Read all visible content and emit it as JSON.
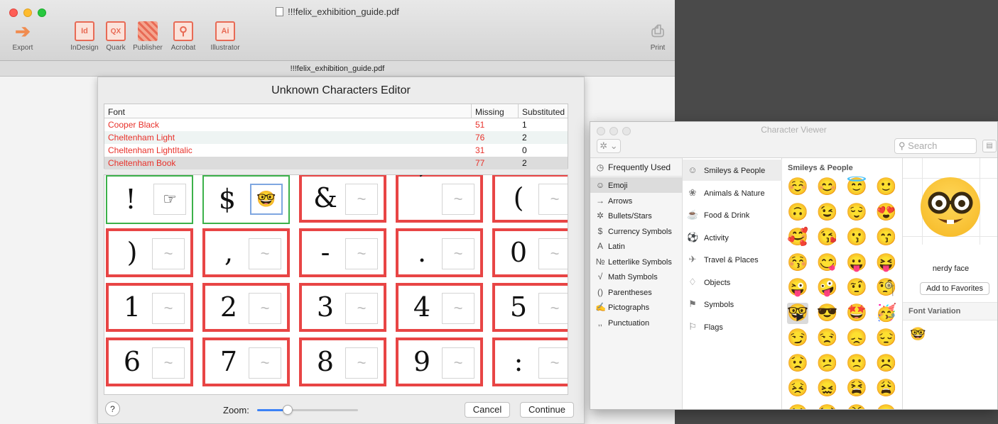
{
  "window": {
    "title": "!!!felix_exhibition_guide.pdf",
    "subtitle": "!!!felix_exhibition_guide.pdf"
  },
  "toolbar": {
    "export_label": "Export",
    "indesign_label": "InDesign",
    "indesign_glyph": "Id",
    "quark_label": "Quark",
    "quark_glyph": "QX",
    "publisher_label": "Publisher",
    "acrobat_label": "Acrobat",
    "illustrator_label": "Illustrator",
    "illustrator_glyph": "Ai",
    "print_label": "Print"
  },
  "editor": {
    "title": "Unknown Characters Editor",
    "columns": {
      "font": "Font",
      "missing": "Missing",
      "substituted": "Substituted"
    },
    "rows": [
      {
        "font": "Cooper Black",
        "missing": "51",
        "substituted": "1"
      },
      {
        "font": "Cheltenham Light",
        "missing": "76",
        "substituted": "2"
      },
      {
        "font": "Cheltenham LightItalic",
        "missing": "31",
        "substituted": "0"
      },
      {
        "font": "Cheltenham Book",
        "missing": "77",
        "substituted": "2"
      }
    ],
    "placeholder_glyph": "~",
    "cells": [
      {
        "char": "!",
        "sub": "☞"
      },
      {
        "char": "$",
        "sub": "🤓"
      },
      {
        "char": "&",
        "sub": ""
      },
      {
        "char": "’",
        "sub": ""
      },
      {
        "char": "(",
        "sub": ""
      },
      {
        "char": ")",
        "sub": ""
      },
      {
        "char": ",",
        "sub": ""
      },
      {
        "char": "-",
        "sub": ""
      },
      {
        "char": ".",
        "sub": ""
      },
      {
        "char": "0",
        "sub": ""
      },
      {
        "char": "1",
        "sub": ""
      },
      {
        "char": "2",
        "sub": ""
      },
      {
        "char": "3",
        "sub": ""
      },
      {
        "char": "4",
        "sub": ""
      },
      {
        "char": "5",
        "sub": ""
      },
      {
        "char": "6",
        "sub": ""
      },
      {
        "char": "7",
        "sub": ""
      },
      {
        "char": "8",
        "sub": ""
      },
      {
        "char": "9",
        "sub": ""
      },
      {
        "char": ":",
        "sub": ""
      }
    ],
    "help_label": "?",
    "zoom_label": "Zoom:",
    "zoom_level": 0.3,
    "cancel_label": "Cancel",
    "continue_label": "Continue"
  },
  "character_viewer": {
    "title": "Character Viewer",
    "gear_label": "✲ ⌄",
    "search_placeholder": "Search",
    "categories": [
      {
        "icon": "◷",
        "label": "Frequently Used"
      },
      {
        "icon": "☺",
        "label": "Emoji"
      },
      {
        "icon": "→",
        "label": "Arrows"
      },
      {
        "icon": "✲",
        "label": "Bullets/Stars"
      },
      {
        "icon": "$",
        "label": "Currency Symbols"
      },
      {
        "icon": "A",
        "label": "Latin"
      },
      {
        "icon": "№",
        "label": "Letterlike Symbols"
      },
      {
        "icon": "√",
        "label": "Math Symbols"
      },
      {
        "icon": "()",
        "label": "Parentheses"
      },
      {
        "icon": "✍",
        "label": "Pictographs"
      },
      {
        "icon": "‚,",
        "label": "Punctuation"
      }
    ],
    "subcategories": [
      {
        "icon": "☺",
        "label": "Smileys & People"
      },
      {
        "icon": "❀",
        "label": "Animals & Nature"
      },
      {
        "icon": "☕",
        "label": "Food & Drink"
      },
      {
        "icon": "⚽",
        "label": "Activity"
      },
      {
        "icon": "✈",
        "label": "Travel & Places"
      },
      {
        "icon": "♢",
        "label": "Objects"
      },
      {
        "icon": "⚑",
        "label": "Symbols"
      },
      {
        "icon": "⚐",
        "label": "Flags"
      }
    ],
    "section_title": "Smileys & People",
    "emojis": [
      "☺️",
      "😊",
      "😇",
      "🙂",
      "🙃",
      "😉",
      "😌",
      "😍",
      "🥰",
      "😘",
      "😗",
      "😙",
      "😚",
      "😋",
      "😛",
      "😝",
      "😜",
      "🤪",
      "🤨",
      "🧐",
      "🤓",
      "😎",
      "🤩",
      "🥳",
      "😏",
      "😒",
      "😞",
      "😔",
      "😟",
      "😕",
      "🙁",
      "☹️",
      "😣",
      "😖",
      "😫",
      "😩",
      "😢",
      "😭",
      "😤",
      "😠"
    ],
    "selected_emoji": "🤓",
    "character_name": "nerdy face",
    "add_to_favorites_label": "Add to Favorites",
    "font_variation_label": "Font Variation"
  }
}
